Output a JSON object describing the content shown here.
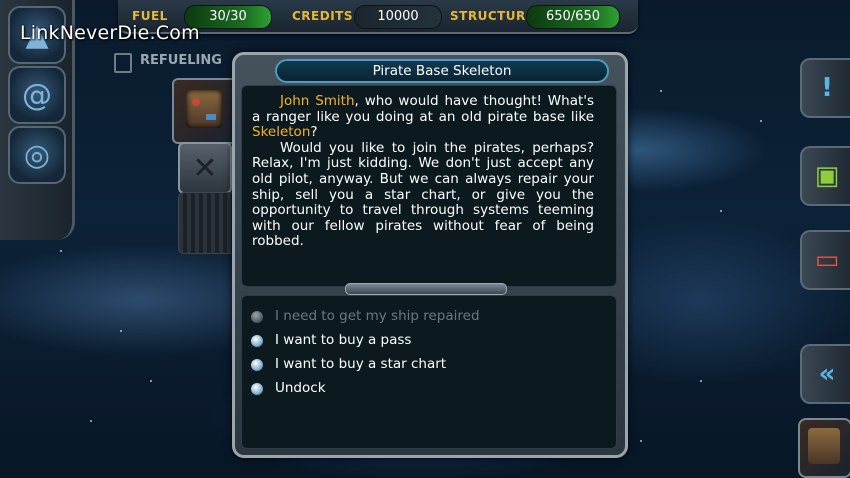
{
  "hud": {
    "fuel_label": "FUEL",
    "fuel_value": "30/30",
    "credits_label": "CREDITS",
    "credits_value": "10000",
    "structure_label": "STRUCTURE",
    "structure_value": "650/650"
  },
  "status": {
    "refueling": "REFUELING"
  },
  "dialog": {
    "title": "Pirate Base Skeleton",
    "player_name": "John Smith",
    "base_name": "Skeleton",
    "p1_mid": ", who would have thought! What's a ranger like you doing at an old pirate base like ",
    "p1_end": "?",
    "p2": "Would you like to join the pirates, perhaps? Relax, I'm just kidding. We don't just accept any old pilot, anyway. But we can always repair your ship, sell you a star chart, or give you the opportunity to travel through systems teeming with our fellow pirates without fear of being robbed.",
    "options": [
      {
        "label": "I need to get my ship repaired",
        "enabled": false
      },
      {
        "label": "I want to buy a pass",
        "enabled": true
      },
      {
        "label": "I want to buy a star chart",
        "enabled": true
      },
      {
        "label": "Undock",
        "enabled": true
      }
    ]
  },
  "icons": {
    "left_rail": [
      "ship-icon",
      "galaxy-icon",
      "radar-icon"
    ],
    "right_rail": [
      "alert-icon",
      "cargo-icon",
      "message-icon",
      "back-icon"
    ]
  },
  "colors": {
    "highlight": "#f2b52a",
    "label_gold": "#e5b73a"
  },
  "watermark": "LinkNeverDie.Com"
}
